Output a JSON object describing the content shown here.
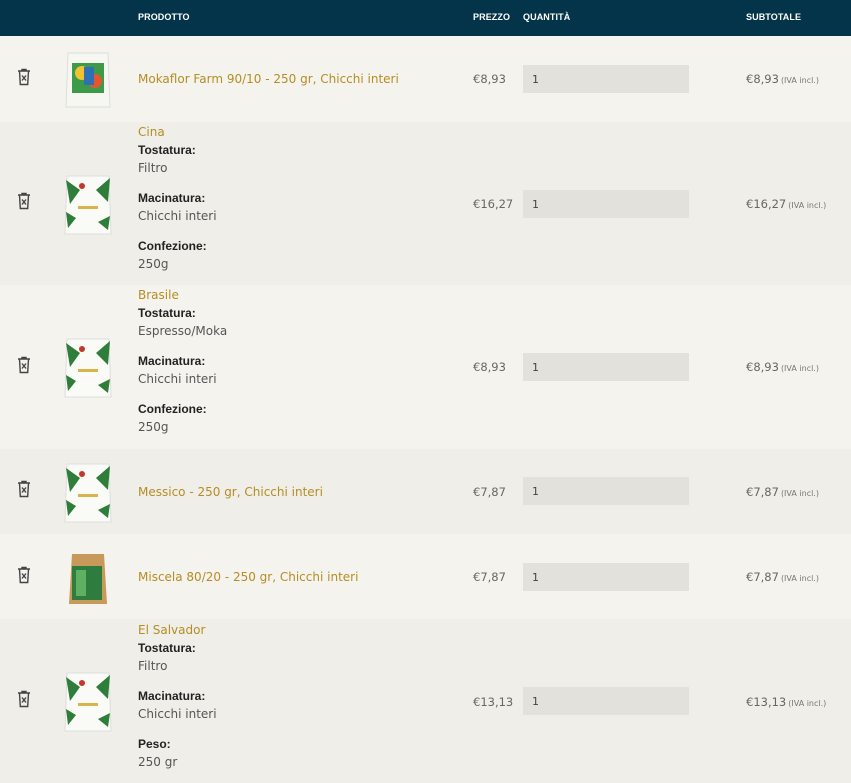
{
  "header": {
    "product": "PRODOTTO",
    "price": "PREZZO",
    "quantity": "QUANTITÀ",
    "subtotal": "SUBTOTALE"
  },
  "colors": {
    "header_bg": "#04344a",
    "link": "#b58d24",
    "row_alt": "#efeee8",
    "row_plain": "#f4f3ee"
  },
  "iva_note": "(IVA incl.)",
  "rows": [
    {
      "name": "Mokaflor Farm 90/10 - 250 gr, Chicchi interi",
      "price": "€8,93",
      "qty": "1",
      "subtotal": "€8,93"
    },
    {
      "name": "Cina",
      "attrs": [
        {
          "label": "Tostatura:",
          "value": "Filtro"
        },
        {
          "label": "Macinatura:",
          "value": "Chicchi interi"
        },
        {
          "label": "Confezione:",
          "value": "250g"
        }
      ],
      "price": "€16,27",
      "qty": "1",
      "subtotal": "€16,27"
    },
    {
      "name": "Brasile",
      "attrs": [
        {
          "label": "Tostatura:",
          "value": "Espresso/Moka"
        },
        {
          "label": "Macinatura:",
          "value": "Chicchi interi"
        },
        {
          "label": "Confezione:",
          "value": "250g"
        }
      ],
      "price": "€8,93",
      "qty": "1",
      "subtotal": "€8,93"
    },
    {
      "name": "Messico - 250 gr, Chicchi interi",
      "price": "€7,87",
      "qty": "1",
      "subtotal": "€7,87"
    },
    {
      "name": "Miscela 80/20 - 250 gr, Chicchi interi",
      "price": "€7,87",
      "qty": "1",
      "subtotal": "€7,87"
    },
    {
      "name": "El Salvador",
      "attrs": [
        {
          "label": "Tostatura:",
          "value": "Filtro"
        },
        {
          "label": "Macinatura:",
          "value": "Chicchi interi"
        },
        {
          "label": "Peso:",
          "value": "250 gr"
        }
      ],
      "price": "€13,13",
      "qty": "1",
      "subtotal": "€13,13"
    }
  ]
}
